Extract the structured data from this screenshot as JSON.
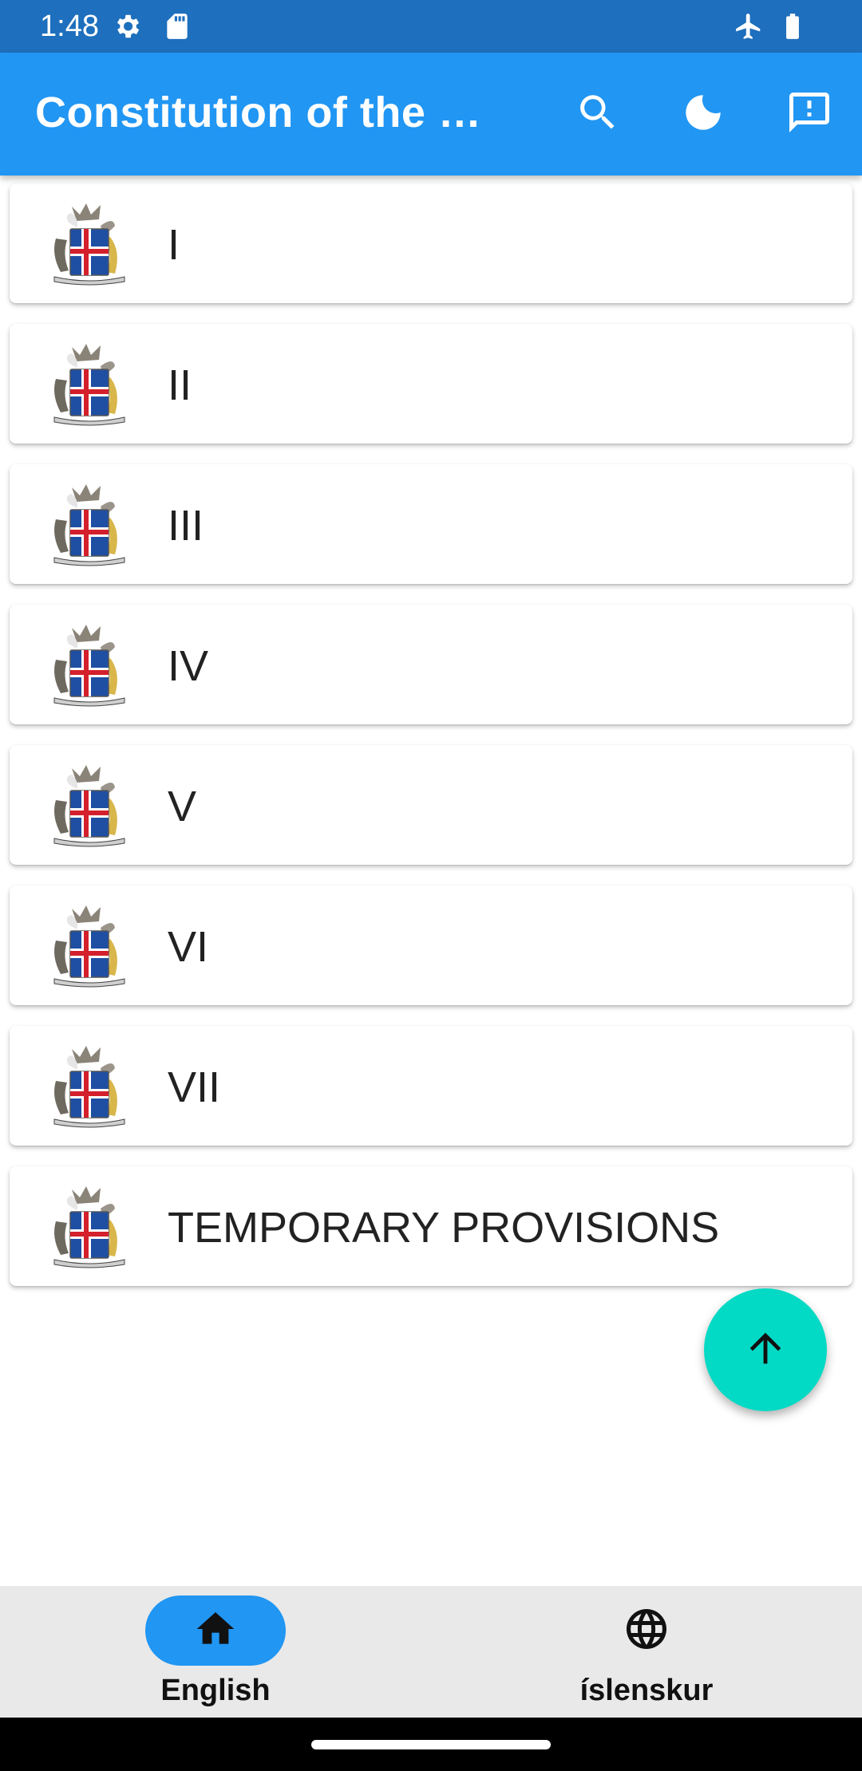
{
  "status_bar": {
    "time": "1:48",
    "left_icons": [
      "settings-gear-icon",
      "sd-card-icon"
    ],
    "right_icons": [
      "airplane-mode-icon",
      "battery-icon"
    ]
  },
  "app_bar": {
    "title": "Constitution of the …",
    "actions": [
      "search-icon",
      "dark-mode-moon-icon",
      "feedback-icon"
    ],
    "color": "#2196f3"
  },
  "chapters": [
    {
      "label": "I",
      "icon": "coat-of-arms-icon"
    },
    {
      "label": "II",
      "icon": "coat-of-arms-icon"
    },
    {
      "label": "III",
      "icon": "coat-of-arms-icon"
    },
    {
      "label": "IV",
      "icon": "coat-of-arms-icon"
    },
    {
      "label": "V",
      "icon": "coat-of-arms-icon"
    },
    {
      "label": "VI",
      "icon": "coat-of-arms-icon"
    },
    {
      "label": "VII",
      "icon": "coat-of-arms-icon"
    },
    {
      "label": "TEMPORARY PROVISIONS",
      "icon": "coat-of-arms-icon"
    }
  ],
  "fab": {
    "icon": "arrow-up-icon",
    "color": "#03dac5"
  },
  "bottom_nav": {
    "items": [
      {
        "label": "English",
        "icon": "home-icon",
        "selected": true
      },
      {
        "label": "íslenskur",
        "icon": "globe-icon",
        "selected": false
      }
    ]
  }
}
